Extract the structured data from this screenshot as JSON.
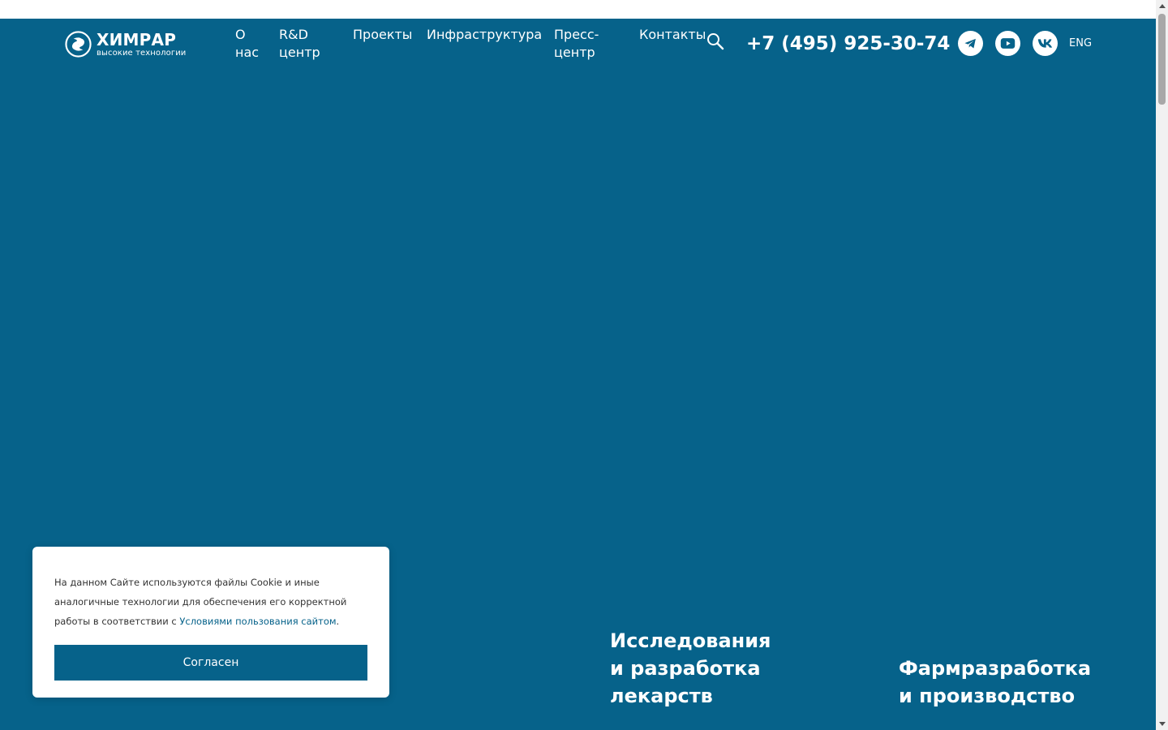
{
  "header": {
    "logo": {
      "title": "ХИМРАР",
      "subtitle": "высокие технологии"
    },
    "nav": [
      {
        "label_lines": [
          "О",
          "нас"
        ]
      },
      {
        "label_lines": [
          "R&D",
          "центр"
        ]
      },
      {
        "label_lines": [
          "Проекты"
        ]
      },
      {
        "label_lines": [
          "Инфраструктура"
        ]
      },
      {
        "label_lines": [
          "Пресс-",
          "центр"
        ]
      },
      {
        "label_lines": [
          "Контакты"
        ]
      }
    ],
    "search_icon": "search-icon",
    "phone": "+7 (495) 925-30-74",
    "social": [
      {
        "icon": "telegram-icon"
      },
      {
        "icon": "youtube-icon"
      },
      {
        "icon": "vk-icon"
      }
    ],
    "lang": "ENG"
  },
  "features": [
    {
      "lines": [
        "Исследования",
        "и разработка",
        "лекарств"
      ]
    },
    {
      "lines": [
        "Фармразработка",
        "и производство"
      ]
    }
  ],
  "cookie": {
    "text_before": "На данном Сайте используются файлы Cookie и иные аналогичные технологии для обеспечения его корректной работы в соответствии с ",
    "link_text": "Условиями пользования сайтом",
    "text_after": ".",
    "button_label": "Согласен"
  },
  "colors": {
    "brand_blue": "#06628a",
    "white": "#ffffff"
  }
}
